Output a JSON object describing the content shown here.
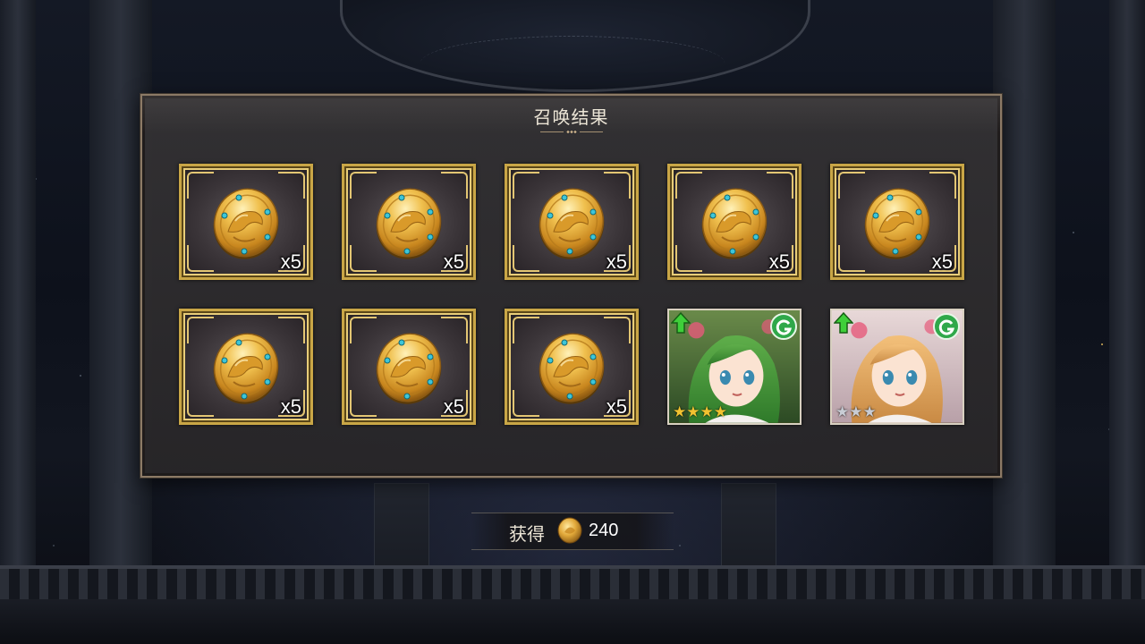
{
  "dialog": {
    "title": "召唤结果"
  },
  "rewards": [
    {
      "kind": "medal",
      "quantity": "x5"
    },
    {
      "kind": "medal",
      "quantity": "x5"
    },
    {
      "kind": "medal",
      "quantity": "x5"
    },
    {
      "kind": "medal",
      "quantity": "x5"
    },
    {
      "kind": "medal",
      "quantity": "x5"
    },
    {
      "kind": "medal",
      "quantity": "x5"
    },
    {
      "kind": "medal",
      "quantity": "x5"
    },
    {
      "kind": "medal",
      "quantity": "x5"
    },
    {
      "kind": "character",
      "character": "green-haired-girl",
      "rarity_stars": 4,
      "element": "wind",
      "upgrade_icon": "green-up-arrow-icon",
      "star_color": "#f2c230"
    },
    {
      "kind": "character",
      "character": "blonde-flower-girl",
      "rarity_stars": 3,
      "element": "wind",
      "upgrade_icon": "green-up-arrow-icon",
      "star_color": "#c8ccd4"
    }
  ],
  "obtain": {
    "label": "获得",
    "value": "240",
    "icon": "gold-medal-icon"
  },
  "colors": {
    "frame_gold": "#c9a646",
    "title_text": "#ece5d6",
    "element_green": "#2fa84a"
  }
}
